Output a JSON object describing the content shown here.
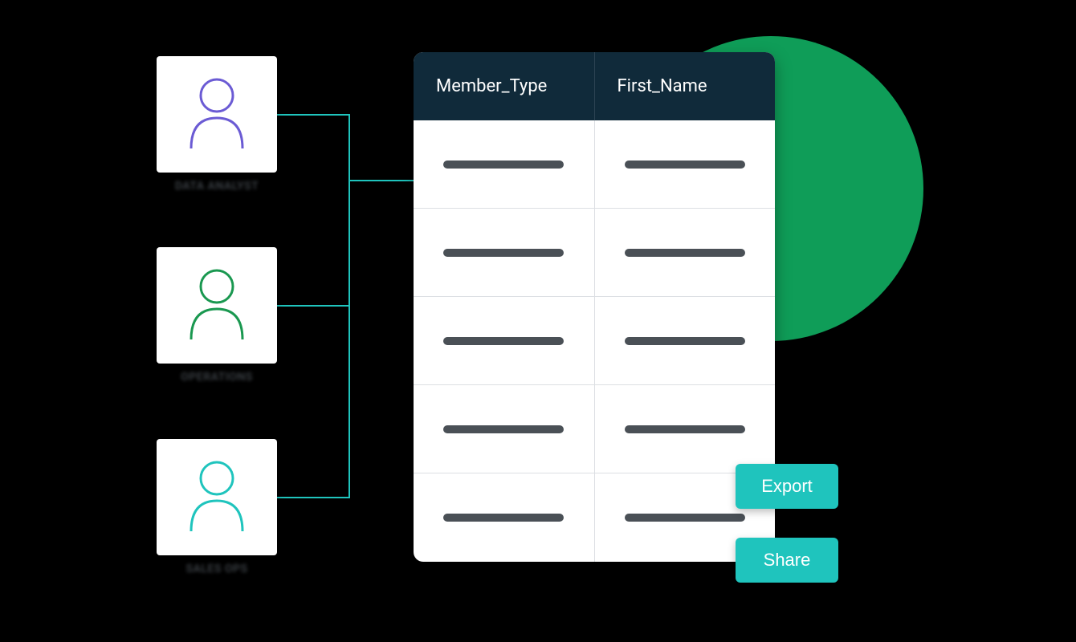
{
  "personas": [
    {
      "label": "DATA ANALYST",
      "color": "#6b5bd4"
    },
    {
      "label": "OPERATIONS",
      "color": "#1a9850"
    },
    {
      "label": "SALES OPS",
      "color": "#1fc4bd"
    }
  ],
  "table": {
    "columns": [
      "Member_Type",
      "First_Name"
    ],
    "row_count": 5
  },
  "actions": {
    "export_label": "Export",
    "share_label": "Share"
  },
  "colors": {
    "accent_circle": "#0f9d58",
    "header_bg": "#102a3a",
    "button_bg": "#1fc4bd",
    "connector": "#1fc4bd"
  }
}
